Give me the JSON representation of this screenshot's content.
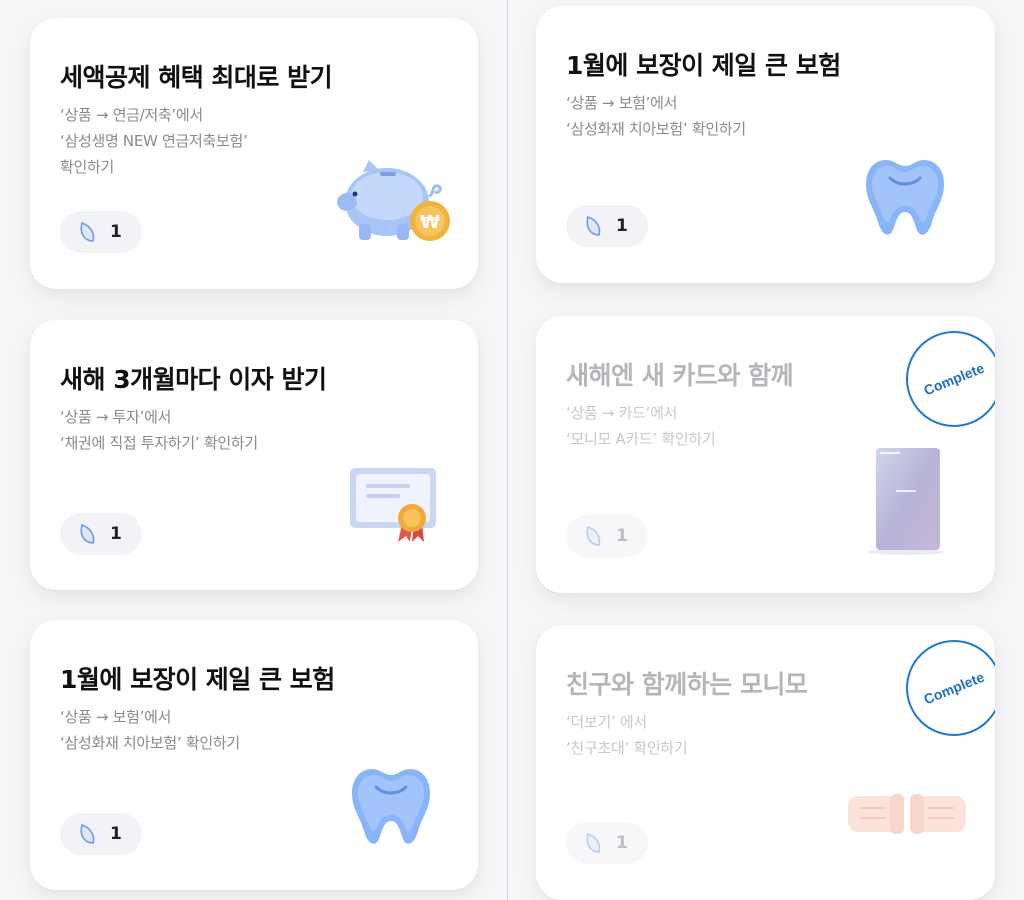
{
  "left_column": {
    "cards": [
      {
        "title": "세액공제 혜택 최대로 받기",
        "desc": [
          "‘상품 → 연금/저축’에서",
          "‘삼성생명 NEW 연금저축보험’",
          "확인하기"
        ],
        "reward_count": "1",
        "illustration": "piggy-bank-icon"
      },
      {
        "title": "새해 3개월마다 이자 받기",
        "desc": [
          "‘상품 → 투자’에서",
          "‘채권에 직접 투자하기’ 확인하기"
        ],
        "reward_count": "1",
        "illustration": "certificate-icon"
      },
      {
        "title": "1월에 보장이 제일 큰 보험",
        "desc": [
          "‘상품 → 보험’에서",
          "‘삼성화재 치아보험’ 확인하기"
        ],
        "reward_count": "1",
        "illustration": "tooth-icon"
      }
    ]
  },
  "right_column": {
    "cards": [
      {
        "title": "1월에 보장이 제일 큰 보험",
        "desc": [
          "‘상품 → 보험’에서",
          "‘삼성화재 치아보험’ 확인하기"
        ],
        "reward_count": "1",
        "illustration": "tooth-icon"
      },
      {
        "title": "새해엔 새 카드와 함께",
        "desc": [
          "‘상품 → 카드’에서",
          "‘모니모 A카드’ 확인하기"
        ],
        "reward_count": "1",
        "illustration": "credit-card-icon",
        "badge": "Complete"
      },
      {
        "title": "친구와 함께하는 모니모",
        "desc": [
          "‘더보기’ 에서",
          "‘친구초대’ 확인하기"
        ],
        "reward_count": "1",
        "illustration": "fist-bump-icon",
        "badge": "Complete"
      }
    ]
  },
  "colors": {
    "accent": "#1f78d1",
    "pill_bg": "#f2f3f7",
    "illustration_blue": "#8ab4f8",
    "coin": "#f0b43c"
  }
}
